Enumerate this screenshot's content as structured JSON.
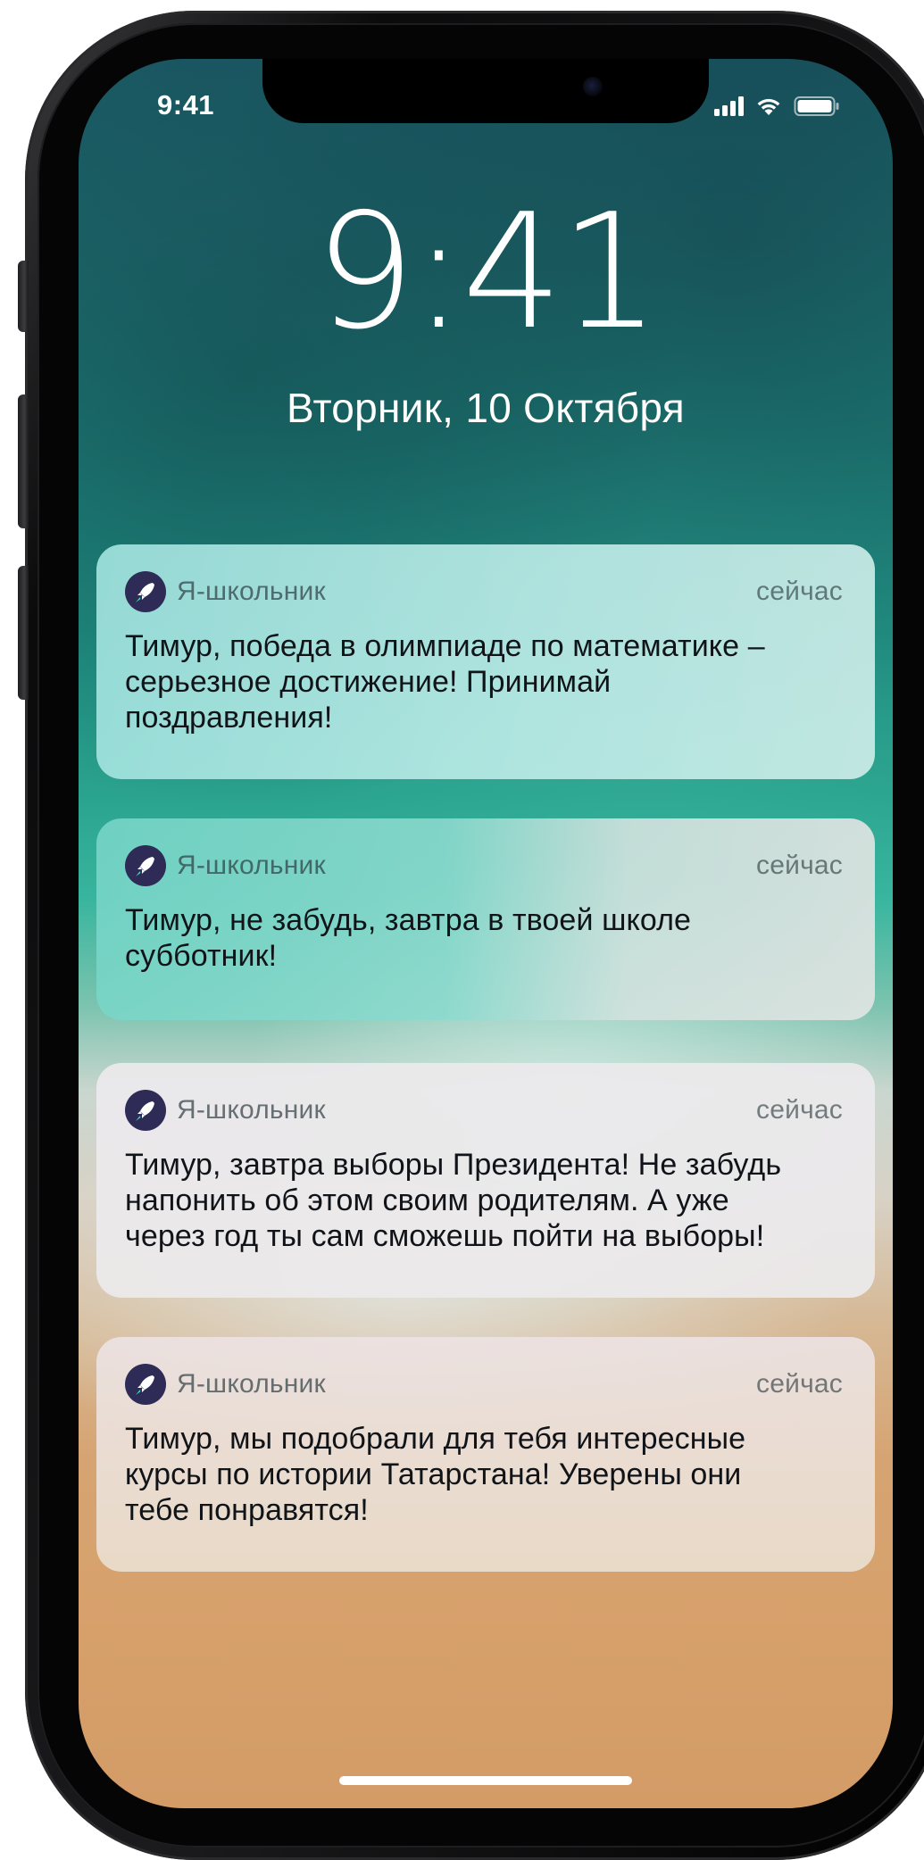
{
  "status_bar": {
    "time": "9:41",
    "signal_icon": "cellular-signal-icon",
    "wifi_icon": "wifi-icon",
    "battery_icon": "battery-full-icon"
  },
  "lock_screen": {
    "time": "9:41",
    "date": "Вторник, 10 Октября"
  },
  "notifications": [
    {
      "app_name": "Я-школьник",
      "time": "сейчас",
      "icon": "rocket-icon",
      "text": "Тимур, победа в олимпиаде по математике –\nсерьезное достижение! Принимай\nпоздравления!"
    },
    {
      "app_name": "Я-школьник",
      "time": "сейчас",
      "icon": "rocket-icon",
      "text": "Тимур, не забудь, завтра в твоей школе\nсубботник!"
    },
    {
      "app_name": "Я-школьник",
      "time": "сейчас",
      "icon": "rocket-icon",
      "text": "Тимур, завтра выборы Президента! Не забудь\nнапонить об этом своим родителям. А уже\nчерез год ты сам сможешь пойти на выборы!"
    },
    {
      "app_name": "Я-школьник",
      "time": "сейчас",
      "icon": "rocket-icon",
      "text": "Тимур, мы подобрали для тебя интересные\nкурсы по истории Татарстана! Уверены они\nтебе понравятся!"
    }
  ],
  "colors": {
    "app_icon_bg": "#2e2b57",
    "rocket_accent": "#3fe0b8",
    "text_primary": "#101418"
  }
}
